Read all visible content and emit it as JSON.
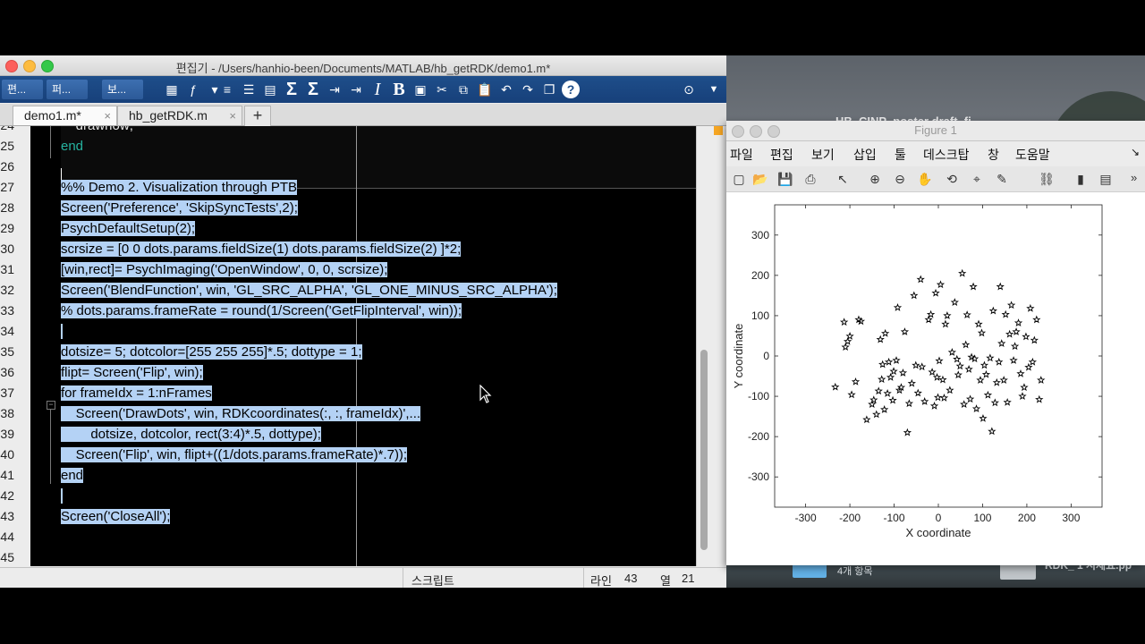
{
  "editor": {
    "title": "편집기 - /Users/hanhio-been/Documents/MATLAB/hb_getRDK/demo1.m*",
    "toolstrip_tabs": [
      "편...",
      "퍼...",
      "보..."
    ],
    "toolbar_icons": [
      "insert-icon",
      "fx-icon",
      "dropdown-icon",
      "comment-icon",
      "list-icon",
      "insert-section-icon",
      "sum-icon",
      "sum-icon",
      "indent-icon",
      "indent-icon",
      "italic-icon",
      "bold-icon",
      "save-icon",
      "cut-icon",
      "copy-icon",
      "paste-icon",
      "undo-icon",
      "redo-icon",
      "window-icon",
      "help-icon"
    ],
    "file_tabs": [
      {
        "label": "demo1.m*",
        "close": "×"
      },
      {
        "label": "hb_getRDK.m",
        "close": "×"
      }
    ],
    "add_tab": "+",
    "lines": [
      {
        "num": "24",
        "text": "    drawnow;",
        "selected": false
      },
      {
        "num": "25",
        "text": "end",
        "selected": false,
        "keyword": true
      },
      {
        "num": "26",
        "text": "",
        "selected": false
      },
      {
        "num": "27",
        "text": "%% Demo 2. Visualization through PTB",
        "selected": true
      },
      {
        "num": "28",
        "text": "Screen('Preference', 'SkipSyncTests',2);",
        "selected": true
      },
      {
        "num": "29",
        "text": "PsychDefaultSetup(2);",
        "selected": true
      },
      {
        "num": "30",
        "text": "scrsize = [0 0 dots.params.fieldSize(1) dots.params.fieldSize(2) ]*2;",
        "selected": true
      },
      {
        "num": "31",
        "text": "[win,rect]= PsychImaging('OpenWindow', 0, 0, scrsize);",
        "selected": true
      },
      {
        "num": "32",
        "text": "Screen('BlendFunction', win, 'GL_SRC_ALPHA', 'GL_ONE_MINUS_SRC_ALPHA');",
        "selected": true
      },
      {
        "num": "33",
        "text": "% dots.params.frameRate = round(1/Screen('GetFlipInterval', win));",
        "selected": true
      },
      {
        "num": "34",
        "text": "",
        "selected": true
      },
      {
        "num": "35",
        "text": "dotsize= 5; dotcolor=[255 255 255]*.5; dottype = 1;",
        "selected": true
      },
      {
        "num": "36",
        "text": "flipt= Screen('Flip', win);",
        "selected": true
      },
      {
        "num": "37",
        "text": "for frameIdx = 1:nFrames",
        "selected": true
      },
      {
        "num": "38",
        "text": "    Screen('DrawDots', win, RDKcoordinates(:, :, frameIdx)',...",
        "selected": true
      },
      {
        "num": "39",
        "text": "        dotsize, dotcolor, rect(3:4)*.5, dottype);",
        "selected": true
      },
      {
        "num": "40",
        "text": "    Screen('Flip', win, flipt+((1/dots.params.frameRate)*.7));",
        "selected": true
      },
      {
        "num": "41",
        "text": "end",
        "selected": true
      },
      {
        "num": "42",
        "text": "",
        "selected": true
      },
      {
        "num": "43",
        "text": "Screen('CloseAll');",
        "selected": true
      },
      {
        "num": "44",
        "text": "",
        "selected": false
      },
      {
        "num": "45",
        "text": "",
        "selected": false
      }
    ],
    "status": {
      "mode": "스크립트",
      "line_label": "라인",
      "line_value": "43",
      "col_label": "열",
      "col_value": "21"
    }
  },
  "desktop": {
    "background_file": "HB_CINP_poster draft_fi",
    "folder_count": "4개 항목",
    "file_label": "RDK_ 1 시제요.pp"
  },
  "figure": {
    "title": "Figure 1",
    "menu": [
      "파일",
      "편집",
      "보기",
      "삽입",
      "툴",
      "데스크탑",
      "창",
      "도움말"
    ],
    "menu_arrow": "↘",
    "tool_icons": [
      "new-icon",
      "open-icon",
      "save-icon",
      "print-icon",
      "pointer-icon",
      "zoom-in-icon",
      "zoom-out-icon",
      "pan-icon",
      "rotate-icon",
      "data-cursor-icon",
      "brush-icon",
      "link-icon",
      "colorbar-icon",
      "legend-icon"
    ],
    "tool_more": "»"
  },
  "chart_data": {
    "type": "scatter",
    "title": "",
    "xlabel": "X coordinate",
    "ylabel": "Y coordinate",
    "xlim": [
      -370,
      370
    ],
    "ylim": [
      -375,
      375
    ],
    "xticks": [
      -300,
      -200,
      -100,
      0,
      100,
      200,
      300
    ],
    "yticks": [
      300,
      200,
      100,
      0,
      -100,
      -200,
      -300
    ],
    "marker": "pentagram",
    "color": "#000000",
    "series": [
      {
        "x": [
          -233,
          -213,
          -210,
          -205,
          -200,
          -196,
          -187,
          -180,
          -175,
          -162,
          -150,
          -146,
          -140,
          -135,
          -131,
          -128,
          -126,
          -122,
          -120,
          -115,
          -112,
          -108,
          -103,
          -101,
          -95,
          -92,
          -88,
          -84,
          -80,
          -76,
          -70,
          -66,
          -60,
          -55,
          -51,
          -46,
          -40,
          -37,
          -31,
          -22,
          -17,
          -14,
          -9,
          -6,
          -3,
          -1,
          2,
          5,
          10,
          13,
          16,
          20,
          26,
          31,
          37,
          42,
          45,
          49,
          54,
          58,
          62,
          65,
          69,
          72,
          75,
          79,
          82,
          86,
          91,
          95,
          98,
          101,
          104,
          108,
          112,
          117,
          121,
          124,
          128,
          132,
          137,
          140,
          143,
          148,
          152,
          156,
          161,
          165,
          170,
          173,
          176,
          181,
          186,
          190,
          194,
          198,
          204,
          208,
          213,
          217,
          222,
          228,
          232
        ],
        "y": [
          -77,
          84,
          22,
          36,
          49,
          -96,
          -64,
          90,
          86,
          -158,
          -120,
          -109,
          -145,
          -87,
          41,
          -58,
          -21,
          -133,
          56,
          -93,
          -15,
          -53,
          -110,
          -38,
          -11,
          120,
          -85,
          -78,
          -42,
          60,
          -190,
          -118,
          -68,
          150,
          -23,
          -92,
          190,
          -27,
          -113,
          90,
          103,
          -40,
          -124,
          156,
          -53,
          -103,
          -12,
          177,
          -59,
          -104,
          79,
          100,
          -85,
          9,
          133,
          -8,
          -47,
          -25,
          205,
          -120,
          28,
          102,
          -33,
          -107,
          -3,
          172,
          -7,
          -131,
          79,
          -60,
          57,
          -155,
          -23,
          -46,
          -97,
          -5,
          -187,
          112,
          -116,
          -66,
          -15,
          172,
          31,
          -60,
          103,
          -115,
          54,
          126,
          -11,
          24,
          60,
          82,
          -44,
          -100,
          -78,
          48,
          -28,
          118,
          -15,
          39,
          90,
          -108,
          -60
        ]
      }
    ]
  }
}
